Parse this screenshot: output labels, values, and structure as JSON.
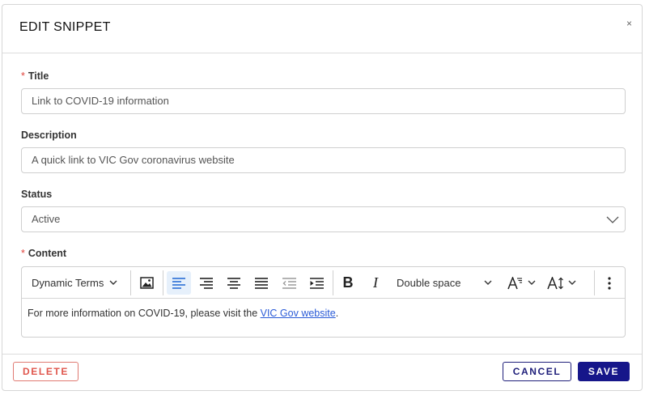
{
  "header": {
    "title": "EDIT SNIPPET",
    "close_label": "×"
  },
  "form": {
    "title": {
      "required_marker": "*",
      "label": "Title",
      "value": "Link to COVID-19 information"
    },
    "description": {
      "label": "Description",
      "value": "A quick link to VIC Gov coronavirus website"
    },
    "status": {
      "label": "Status",
      "value": "Active"
    },
    "content": {
      "required_marker": "*",
      "label": "Content",
      "toolbar": {
        "dynamic_terms": "Dynamic Terms",
        "spacing": "Double space",
        "bold": "B",
        "italic": "I",
        "active_alignment": "align-left"
      },
      "body": {
        "text": "For more information on COVID-19, please visit the ",
        "link_text": "VIC Gov website",
        "trailing": "."
      }
    }
  },
  "footer": {
    "delete_label": "DELETE",
    "cancel_label": "CANCEL",
    "save_label": "SAVE"
  },
  "colors": {
    "required": "#e0443c",
    "primary": "#16168a",
    "danger": "#e0574e",
    "link": "#2a5bd7",
    "active_tool_bg": "#e6f0fb"
  }
}
